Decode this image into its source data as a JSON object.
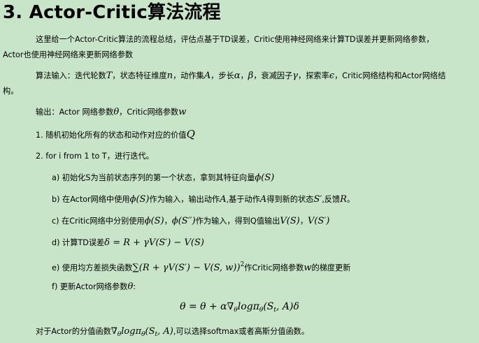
{
  "heading": "3. Actor-Critic算法流程",
  "intro_line1": "这里给一个Actor-Critic算法的流程总结，评估点基于TD误差，Critic使用神经网络来计算TD误差并更新网络参数，",
  "intro_line2": "Actor也使用神经网络来更新网络参数",
  "input": {
    "prefix": "算法输入：迭代轮数",
    "T": "T",
    "p2": "，状态特征维度",
    "n": "n",
    "p3": "，动作集",
    "A": "A",
    "p4": "，步长",
    "alpha": "α",
    "comma1": "，",
    "beta": "β",
    "p5": "，衰减因子",
    "gamma": "γ",
    "p6": "，探索率",
    "eps": "ϵ",
    "p7": "，Critic网络结构和Actor网络结",
    "line2": "构。"
  },
  "output": {
    "prefix": "输出：Actor 网络参数",
    "theta": "θ",
    "p2": "，Critic网络参数",
    "w": "w"
  },
  "step1": {
    "text": "1. 随机初始化所有的状态和动作对应的价值",
    "Q": "Q"
  },
  "step2": "2. for i from 1 to T，进行迭代。",
  "sa": {
    "text": "a) 初始化S为当前状态序列的第一个状态，拿到其特征向量",
    "math": "ϕ(S)"
  },
  "sb": {
    "p1": "b) 在Actor网络中使用",
    "m1": "ϕ(S)",
    "p2": "作为输入，输出动作",
    "m2": "A",
    "p3": ",基于动作",
    "m3": "A",
    "p4": "得到新的状态",
    "m4": "S′",
    "p5": ",反馈",
    "m5": "R",
    "p6": "。"
  },
  "sc": {
    "p1": "c) 在Critic网络中分别使用",
    "m1": "ϕ(S)",
    "p2": "，",
    "m2": "ϕ(S′′)",
    "p3": "作为输入，得到Q值输出",
    "m3": "V(S)",
    "p4": "，",
    "m4": "V(S′)"
  },
  "sd": {
    "p1": "d) 计算TD误差",
    "math": "δ = R + γV(S′) − V(S)"
  },
  "se": {
    "p1": "e) 使用均方差损失函数",
    "math": "∑(R + γV(S′) − V(S, w))",
    "sup": "2",
    "p2": "作Critic网络参数",
    "w": "w",
    "p3": "的梯度更新"
  },
  "sf": {
    "p1": "f)  更新Actor网络参数",
    "theta": "θ",
    "p2": ":"
  },
  "formula": {
    "lhs": "θ = θ + α∇",
    "sub1": "θ",
    "mid": "logπ",
    "sub2": "θ",
    "arg": "(S",
    "sub3": "t",
    "end": ", A)δ"
  },
  "footer": {
    "p1": "对于Actor的分值函数",
    "m1": "∇",
    "sub1": "θ",
    "m2": "logπ",
    "sub2": "θ",
    "m3": "(S",
    "sub3": "t",
    "m4": ", A)",
    "p2": ",可以选择softmax或者高斯分值函数。"
  }
}
